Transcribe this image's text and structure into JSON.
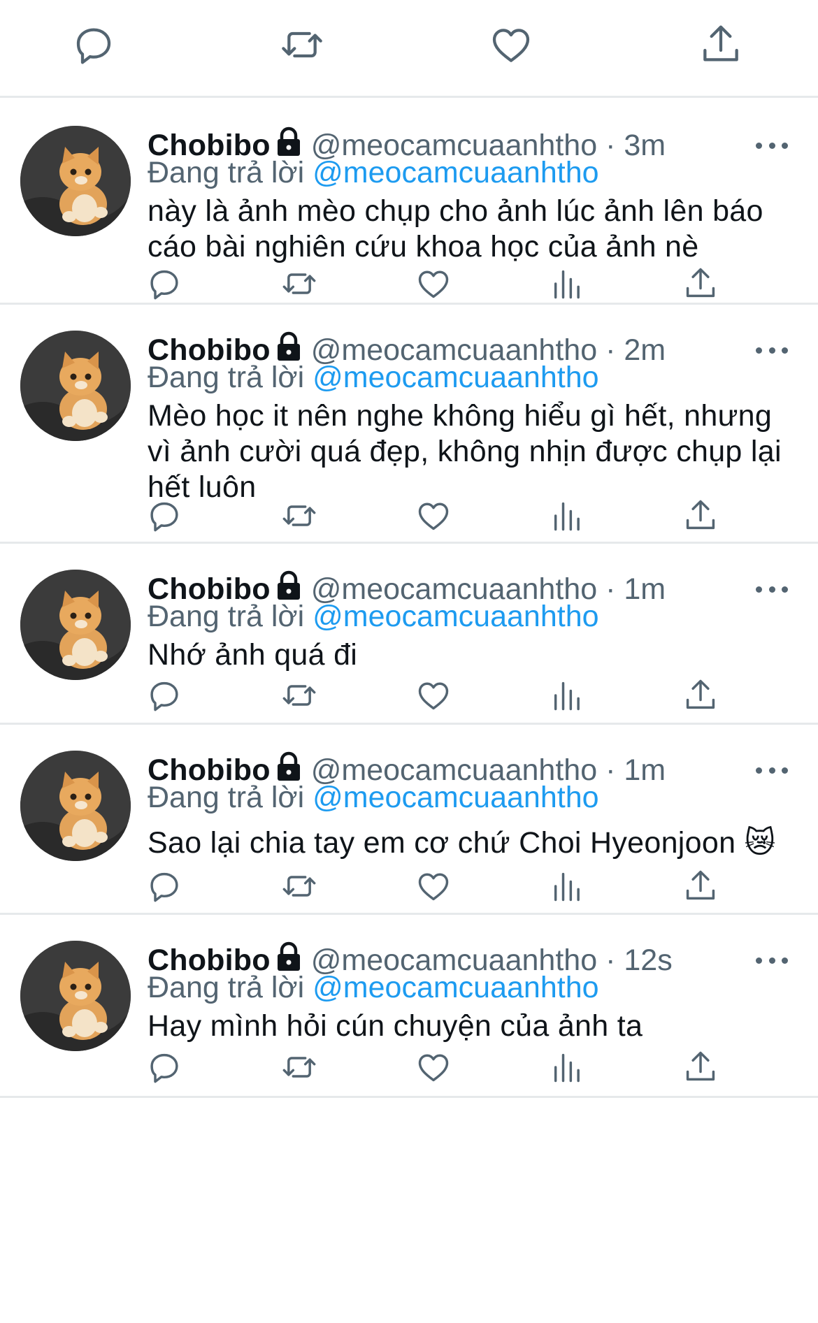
{
  "top_bar": {
    "icons": [
      "reply-icon",
      "retweet-icon",
      "like-icon",
      "share-icon"
    ]
  },
  "theme": {
    "text": "#0f1419",
    "secondary": "#536471",
    "accent": "#1d9bf0",
    "divider": "#e6e9eb"
  },
  "tweets": [
    {
      "name": "Chobibo",
      "handle": "@meocamcuaanhtho",
      "separator": "·",
      "time": "3m",
      "reply_prefix": "Đang trả lời",
      "reply_to": "@meocamcuaanhtho",
      "text": "này là ảnh mèo chụp cho ảnh lúc ảnh lên báo cáo bài nghiên cứu khoa học của ảnh nè"
    },
    {
      "name": "Chobibo",
      "handle": "@meocamcuaanhtho",
      "separator": "·",
      "time": "2m",
      "reply_prefix": "Đang trả lời",
      "reply_to": "@meocamcuaanhtho",
      "text": "Mèo học it nên nghe không hiểu gì hết, nhưng vì ảnh cười quá đẹp, không nhịn được chụp lại hết luôn"
    },
    {
      "name": "Chobibo",
      "handle": "@meocamcuaanhtho",
      "separator": "·",
      "time": "1m",
      "reply_prefix": "Đang trả lời",
      "reply_to": "@meocamcuaanhtho",
      "text": "Nhớ ảnh quá đi"
    },
    {
      "name": "Chobibo",
      "handle": "@meocamcuaanhtho",
      "separator": "·",
      "time": "1m",
      "reply_prefix": "Đang trả lời",
      "reply_to": "@meocamcuaanhtho",
      "text": "Sao lại chia tay em cơ chứ Choi Hyeonjoon 😿"
    },
    {
      "name": "Chobibo",
      "handle": "@meocamcuaanhtho",
      "separator": "·",
      "time": "12s",
      "reply_prefix": "Đang trả lời",
      "reply_to": "@meocamcuaanhtho",
      "text": "Hay mình hỏi cún chuyện của ảnh ta"
    }
  ],
  "tweet_action_icons": [
    "reply-icon",
    "retweet-icon",
    "like-icon",
    "analytics-icon",
    "share-icon"
  ]
}
